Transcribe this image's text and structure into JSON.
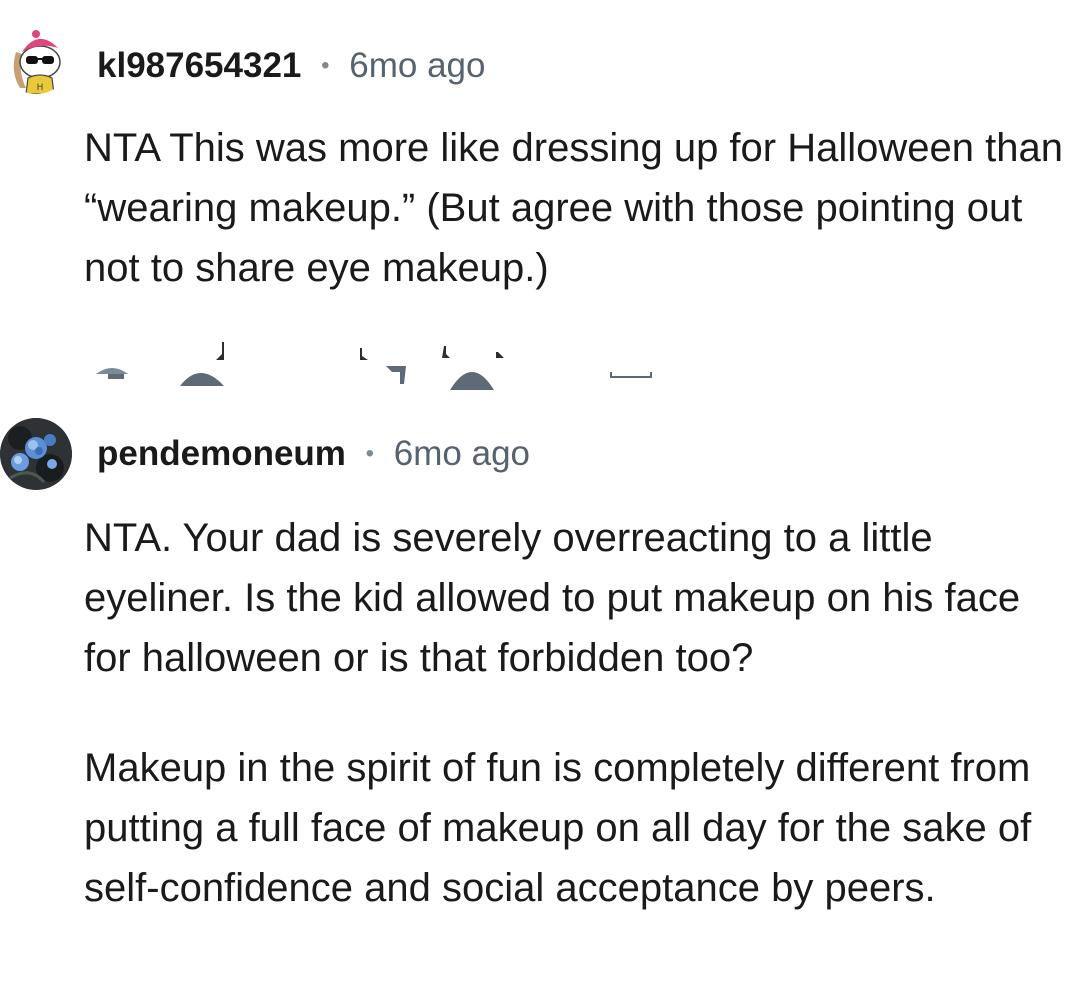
{
  "comments": [
    {
      "username": "kl987654321",
      "separator": "•",
      "time": "6mo ago",
      "avatar_icon": "snoo-sunglasses-avatar",
      "paragraphs": [
        "NTA This was more like dressing up for Halloween than “wearing makeup.” (But agree with those pointing out not to share eye makeup.)"
      ]
    },
    {
      "username": "pendemoneum",
      "separator": "•",
      "time": "6mo ago",
      "avatar_icon": "blue-flowers-avatar",
      "paragraphs": [
        "NTA. Your dad is severely overreacting to a little eyeliner. Is the kid allowed to put makeup on his face for halloween or is that forbidden too?",
        "Makeup in the spirit of fun is completely different from putting a full face of makeup on all day for the sake of self-confidence and social acceptance by peers."
      ]
    }
  ],
  "action_bar": {
    "icons": [
      "upvote-icon",
      "downvote-icon",
      "reply-icon",
      "award-icon",
      "more-icon"
    ],
    "icon_color": "#5e6a75"
  }
}
